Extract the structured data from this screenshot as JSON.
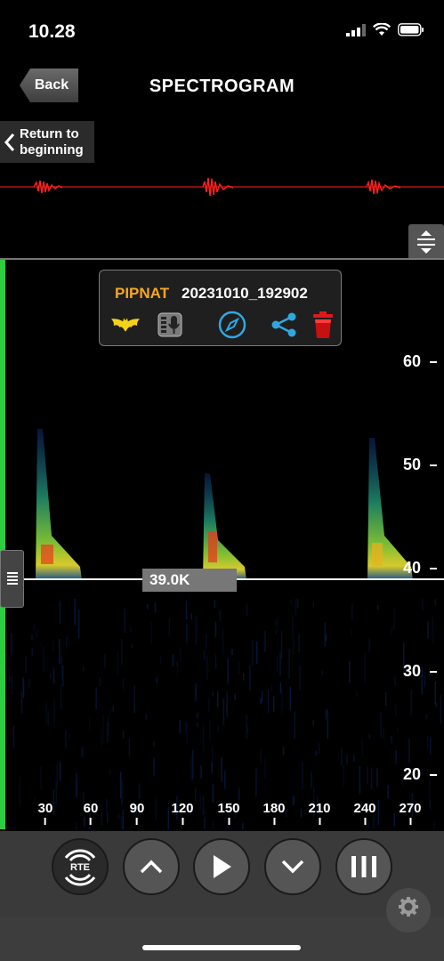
{
  "status": {
    "time": "10.28"
  },
  "header": {
    "back_label": "Back",
    "title": "SPECTROGRAM"
  },
  "return_button": {
    "label": "Return to\nbeginning"
  },
  "info_card": {
    "species": "PIPNAT",
    "filename": "20231010_192902"
  },
  "frequency_marker": {
    "label": "39.0K",
    "value_khz": 39.0
  },
  "y_axis": {
    "ticks": [
      "60",
      "50",
      "40",
      "30",
      "20"
    ]
  },
  "x_axis": {
    "ticks": [
      "30",
      "60",
      "90",
      "120",
      "150",
      "180",
      "210",
      "240",
      "270"
    ]
  },
  "controls": {
    "rte_label": "RTE"
  },
  "colors": {
    "accent_green": "#2ecc40",
    "species_orange": "#f5a623",
    "waveform_red": "#ff2020",
    "icon_blue": "#2fa8e0"
  }
}
